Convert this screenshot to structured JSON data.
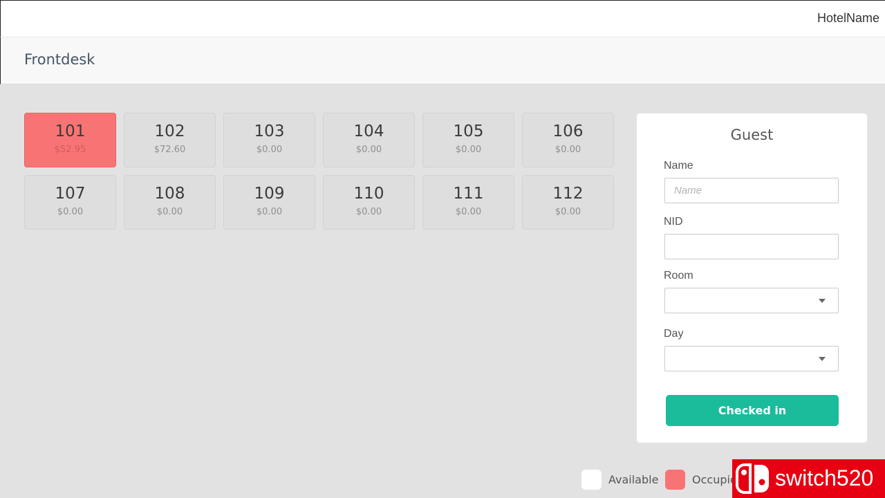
{
  "header": {
    "hotel_name": "HotelName"
  },
  "subheader": {
    "title": "Frontdesk"
  },
  "rooms": [
    {
      "number": "101",
      "price": "$52.95",
      "status": "occupied"
    },
    {
      "number": "102",
      "price": "$72.60",
      "status": "available"
    },
    {
      "number": "103",
      "price": "$0.00",
      "status": "available"
    },
    {
      "number": "104",
      "price": "$0.00",
      "status": "available"
    },
    {
      "number": "105",
      "price": "$0.00",
      "status": "available"
    },
    {
      "number": "106",
      "price": "$0.00",
      "status": "available"
    },
    {
      "number": "107",
      "price": "$0.00",
      "status": "available"
    },
    {
      "number": "108",
      "price": "$0.00",
      "status": "available"
    },
    {
      "number": "109",
      "price": "$0.00",
      "status": "available"
    },
    {
      "number": "110",
      "price": "$0.00",
      "status": "available"
    },
    {
      "number": "111",
      "price": "$0.00",
      "status": "available"
    },
    {
      "number": "112",
      "price": "$0.00",
      "status": "available"
    }
  ],
  "guest_form": {
    "title": "Guest",
    "name_label": "Name",
    "name_placeholder": "Name",
    "name_value": "",
    "nid_label": "NID",
    "nid_value": "",
    "room_label": "Room",
    "room_value": "",
    "day_label": "Day",
    "day_value": "",
    "submit_label": "Checked in"
  },
  "legend": {
    "available_label": "Available",
    "occupied_label": "Occupied"
  },
  "watermark": {
    "text": "switch520"
  },
  "colors": {
    "accent": "#1abc9c",
    "occupied": "#f87474",
    "available": "#ffffff",
    "watermark_red": "#e60012"
  },
  "icons": {
    "select_caret": "caret-down-icon",
    "watermark_logo": "switch-logo-icon"
  }
}
